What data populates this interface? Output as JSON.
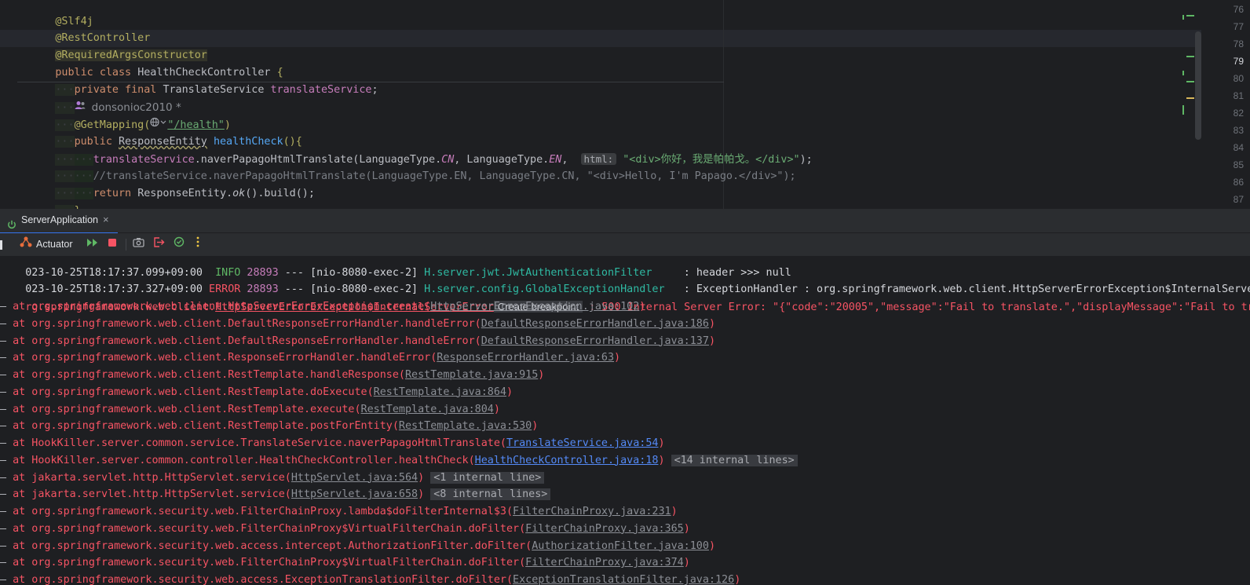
{
  "editor": {
    "lines": {
      "l1": "@Slf4j",
      "l2": "@RestController",
      "l3": "@RequiredArgsConstructor",
      "l4_kw1": "public",
      "l4_kw2": "class",
      "l4_name": "HealthCheckController",
      "l4_brace": "{",
      "l5_kw1": "private",
      "l5_kw2": "final",
      "l5_type": "TranslateService",
      "l5_field": "translateService",
      "author": "donsonioc2010 *",
      "mapping_ann": "@GetMapping(",
      "mapping_path": "\"/health\"",
      "mapping_close": ")",
      "l8_kw": "public",
      "l8_type": "ResponseEntity",
      "l8_method": "healthCheck",
      "l8_rest": "(){",
      "l9_field": "translateService",
      "l9_call": ".naverPapagoHtmlTranslate(LanguageType.",
      "l9_cn": "CN",
      "l9_mid": ", LanguageType.",
      "l9_en": "EN",
      "l9_comma": ", ",
      "l9_hint": "html:",
      "l9_str": "\"<div>你好，我是帕帕戈。</div>\"",
      "l9_end": ");",
      "l10_comment": "//translateService.naverPapagoHtmlTranslate(LanguageType.EN, LanguageType.CN, \"<div>Hello, I'm Papago.</div>\");",
      "l11_kw": "return",
      "l11_a": "ResponseEntity.",
      "l11_ok": "ok",
      "l11_b": "().build();",
      "l12": "}"
    },
    "line_numbers": [
      "76",
      "77",
      "78",
      "79",
      "80",
      "81",
      "82",
      "83",
      "84",
      "85",
      "86",
      "87"
    ]
  },
  "run_tab": {
    "label": "ServerApplication",
    "close": "×"
  },
  "toolbar": {
    "actuator_label": "Actuator"
  },
  "console": {
    "info_line": {
      "ts": "023-10-25T18:17:37.099+09:00",
      "level": "INFO",
      "pid": "28893",
      "sep": "---",
      "thread": "[nio-8080-exec-2]",
      "logger": "H.server.jwt.JwtAuthenticationFilter",
      "msg": ": header >>> null"
    },
    "error_line": {
      "ts": "023-10-25T18:17:37.327+09:00",
      "level": "ERROR",
      "pid": "28893",
      "sep": "---",
      "thread": "[nio-8080-exec-2]",
      "logger": "H.server.config.GlobalExceptionHandler",
      "msg": ": ExceptionHandler : org.springframework.web.client.HttpServerErrorException$InternalServerError: 500 Interna"
    },
    "exception_line": {
      "prefix": "rg.springframework.web.client.",
      "cls": "HttpServerErrorException$InternalServerError",
      "bp": "Create breakpoint",
      "msg": ": 500 Internal Server Error: \"{\"code\":\"20005\",\"message\":\"Fail to translate.\",\"displayMessage\":\"Fail to translate.\"}\""
    },
    "frames": [
      {
        "text": "at org.springframework.web.client.HttpServerErrorException.create(",
        "link": "HttpServerErrorException.java:102",
        "fold": ""
      },
      {
        "text": "at org.springframework.web.client.DefaultResponseErrorHandler.handleError(",
        "link": "DefaultResponseErrorHandler.java:186",
        "fold": ""
      },
      {
        "text": "at org.springframework.web.client.DefaultResponseErrorHandler.handleError(",
        "link": "DefaultResponseErrorHandler.java:137",
        "fold": ""
      },
      {
        "text": "at org.springframework.web.client.ResponseErrorHandler.handleError(",
        "link": "ResponseErrorHandler.java:63",
        "fold": ""
      },
      {
        "text": "at org.springframework.web.client.RestTemplate.handleResponse(",
        "link": "RestTemplate.java:915",
        "fold": ""
      },
      {
        "text": "at org.springframework.web.client.RestTemplate.doExecute(",
        "link": "RestTemplate.java:864",
        "fold": ""
      },
      {
        "text": "at org.springframework.web.client.RestTemplate.execute(",
        "link": "RestTemplate.java:804",
        "fold": ""
      },
      {
        "text": "at org.springframework.web.client.RestTemplate.postForEntity(",
        "link": "RestTemplate.java:530",
        "fold": ""
      },
      {
        "text": "at HookKiller.server.common.service.TranslateService.naverPapagoHtmlTranslate(",
        "link": "TranslateService.java:54",
        "fold": "",
        "blue": true
      },
      {
        "text": "at HookKiller.server.common.controller.HealthCheckController.healthCheck(",
        "link": "HealthCheckController.java:18",
        "fold": "<14 internal lines>",
        "blue": true
      },
      {
        "text": "at jakarta.servlet.http.HttpServlet.service(",
        "link": "HttpServlet.java:564",
        "fold": "<1 internal line>"
      },
      {
        "text": "at jakarta.servlet.http.HttpServlet.service(",
        "link": "HttpServlet.java:658",
        "fold": "<8 internal lines>"
      },
      {
        "text": "at org.springframework.security.web.FilterChainProxy.lambda$doFilterInternal$3(",
        "link": "FilterChainProxy.java:231",
        "fold": ""
      },
      {
        "text": "at org.springframework.security.web.FilterChainProxy$VirtualFilterChain.doFilter(",
        "link": "FilterChainProxy.java:365",
        "fold": ""
      },
      {
        "text": "at org.springframework.security.web.access.intercept.AuthorizationFilter.doFilter(",
        "link": "AuthorizationFilter.java:100",
        "fold": ""
      },
      {
        "text": "at org.springframework.security.web.FilterChainProxy$VirtualFilterChain.doFilter(",
        "link": "FilterChainProxy.java:374",
        "fold": ""
      },
      {
        "text": "at org.springframework.security.web.access.ExceptionTranslationFilter.doFilter(",
        "link": "ExceptionTranslationFilter.java:126",
        "fold": ""
      }
    ],
    "frame_dash": "—",
    "close_paren": ")"
  },
  "colors": {
    "error": "#f75464",
    "accent": "#3574f0",
    "run_green": "#5fb865"
  },
  "icons": [
    "user-icon",
    "globe-icon",
    "power-icon",
    "actuator-icon",
    "rerun-icon",
    "stop-icon",
    "camera-icon",
    "exit-icon",
    "debug-icon",
    "more-icon"
  ]
}
